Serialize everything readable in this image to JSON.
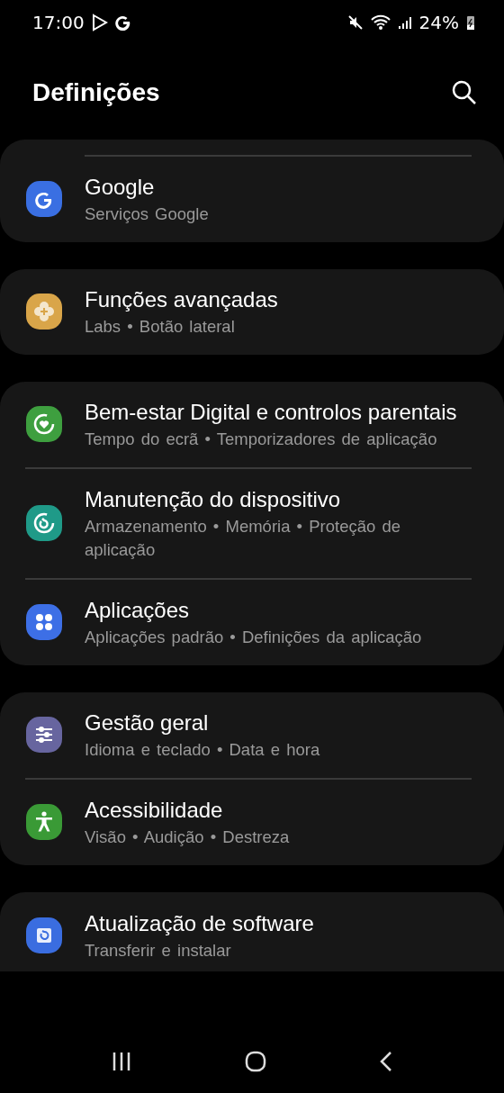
{
  "status_bar": {
    "time": "17:00",
    "battery": "24%"
  },
  "header": {
    "title": "Definições"
  },
  "groups": [
    {
      "top_divider": true,
      "cut_bottom": false,
      "items": [
        {
          "kind": "google",
          "color": "#3a6fe2",
          "title": "Google",
          "subtitle": "Serviços Google"
        }
      ]
    },
    {
      "top_divider": false,
      "cut_bottom": false,
      "items": [
        {
          "kind": "flower",
          "color": "#d9a549",
          "title": "Funções avançadas",
          "subtitle": "Labs • Botão lateral"
        }
      ]
    },
    {
      "top_divider": false,
      "cut_bottom": false,
      "items": [
        {
          "kind": "heart-ring",
          "color": "#3e9f3f",
          "title": "Bem-estar Digital e controlos parentais",
          "subtitle": "Tempo do ecrã • Temporizadores de aplicação"
        },
        {
          "kind": "refresh-ring",
          "color": "#1f9a88",
          "title": "Manutenção do dispositivo",
          "subtitle": "Armazenamento • Memória • Proteção de aplicação"
        },
        {
          "kind": "dots",
          "color": "#3d6fe6",
          "title": "Aplicações",
          "subtitle": "Aplicações padrão • Definições da aplicação"
        }
      ]
    },
    {
      "top_divider": false,
      "cut_bottom": false,
      "items": [
        {
          "kind": "sliders",
          "color": "#67659f",
          "title": "Gestão geral",
          "subtitle": "Idioma e teclado • Data e hora"
        },
        {
          "kind": "person",
          "color": "#3a9a36",
          "title": "Acessibilidade",
          "subtitle": "Visão • Audição • Destreza"
        }
      ]
    },
    {
      "top_divider": false,
      "cut_bottom": true,
      "items": [
        {
          "kind": "update",
          "color": "#3a6de0",
          "title": "Atualização de software",
          "subtitle": "Transferir e instalar"
        }
      ]
    }
  ]
}
